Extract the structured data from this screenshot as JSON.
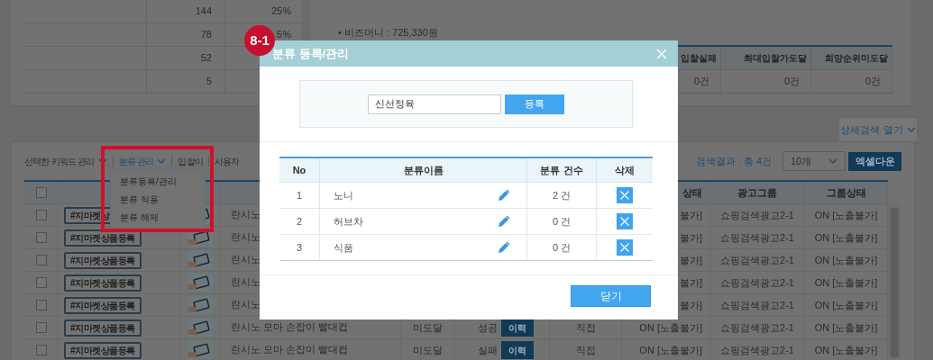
{
  "summary_panel": {
    "rows": [
      {
        "count": "144",
        "share": "25%"
      },
      {
        "count": "78",
        "share": "5%"
      },
      {
        "count": "52"
      },
      {
        "count": "5"
      }
    ]
  },
  "account_info": {
    "bullets": [
      "• 비즈머니 : 725,330원"
    ]
  },
  "result_summary": {
    "columns": [
      "입찰실패",
      "최대입찰가도달",
      "희망순위미도달"
    ],
    "values": [
      "0건",
      "0건",
      "0건"
    ]
  },
  "detail_search_button": "상세검색 열기",
  "toolbar": {
    "menus": [
      {
        "label": "선택한 키워드 관리",
        "dropdown": true,
        "selected": false
      },
      {
        "label": "분류 관리",
        "dropdown": true,
        "selected": true
      },
      {
        "label": "입찰이",
        "dropdown": false,
        "selected": false
      },
      {
        "label": "사용자",
        "dropdown": false,
        "selected": false
      }
    ],
    "result_count": "검색결과 : 총 4건",
    "page_size": "10개",
    "excel_button": "엑셀다운"
  },
  "dropdown_menu": [
    "분류등록/관리",
    "분류 적용",
    "분류 해제"
  ],
  "keyword_table": {
    "select_all_checked": false,
    "headers": {
      "status": "상태",
      "group": "광고그룹",
      "group_status": "그룹상태"
    },
    "rows": [
      {
        "checked": false,
        "tag": "#지마켓상",
        "product": "란시노",
        "status": "불가]",
        "group": "쇼핑검색광고2-1",
        "group_status": "ON [노출불가]"
      },
      {
        "checked": false,
        "tag": "#지마켓상품등록",
        "product": "란시노",
        "status": "불가]",
        "group": "쇼핑검색광고2-1",
        "group_status": "ON [노출불가]"
      },
      {
        "checked": false,
        "tag": "#지마켓상품등록",
        "product": "란시노",
        "status": "불가]",
        "group": "쇼핑검색광고2-1",
        "group_status": "ON [노출불가]"
      },
      {
        "checked": false,
        "tag": "#지마켓상품등록",
        "product": "란시노",
        "status": "불가]",
        "group": "쇼핑검색광고2-1",
        "group_status": "ON [노출불가]"
      },
      {
        "checked": false,
        "tag": "#지마켓상품등록",
        "product": "란시노",
        "status": "불가]",
        "group": "쇼핑검색광고2-1",
        "group_status": "ON [노출불가]"
      },
      {
        "checked": false,
        "tag": "#지마켓상품등록",
        "product": "란시노 모마 손잡이 빨대컵",
        "grade": "미도달",
        "result": "성공",
        "history": "이력",
        "method": "직접",
        "status": "ON [노출불가]",
        "group": "쇼핑검색광고2-1",
        "group_status": "ON [노출불가]"
      },
      {
        "checked": false,
        "tag": "#지마켓상품등록",
        "product": "란시노 모마 손잡이 빨대컵",
        "grade": "미도달",
        "result": "실패",
        "history": "이력",
        "method": "직접",
        "status": "ON [노출불가]",
        "group": "쇼핑검색광고2-1",
        "group_status": "ON [노출불가]"
      }
    ]
  },
  "step_badge": "8-1",
  "dialog": {
    "title": "분류 등록/관리",
    "input_value": "신선정육",
    "register_button": "등록",
    "columns": [
      "No",
      "분류이름",
      "분류 건수",
      "삭제"
    ],
    "rows": [
      {
        "no": "1",
        "name": "노니",
        "count": "2 건"
      },
      {
        "no": "2",
        "name": "허브차",
        "count": "0 건"
      },
      {
        "no": "3",
        "name": "식품",
        "count": "0 건"
      }
    ],
    "close_button": "닫기"
  }
}
